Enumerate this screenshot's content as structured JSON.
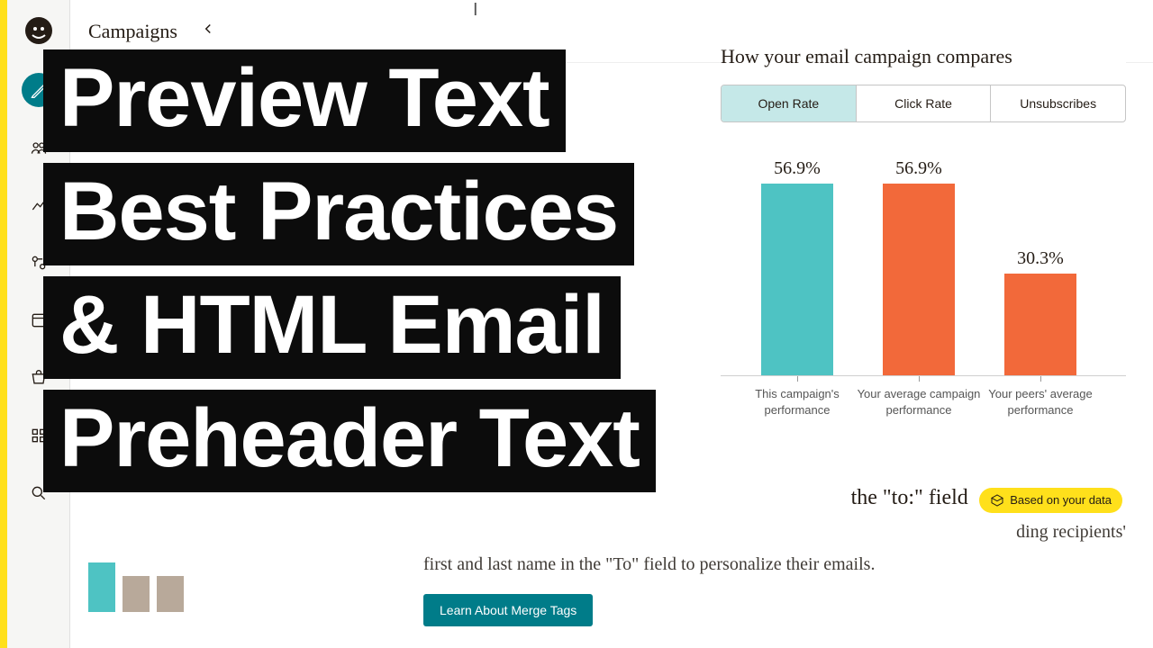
{
  "sidebar": {
    "section": "Campaigns",
    "icons": [
      "create",
      "audience",
      "analytics",
      "automations",
      "content",
      "commerce",
      "apps",
      "search"
    ]
  },
  "card": {
    "title": "How your email campaign compares",
    "tabs": [
      "Open Rate",
      "Click Rate",
      "Unsubscribes"
    ],
    "active_tab": 0
  },
  "chart_data": {
    "type": "bar",
    "title": "How your email campaign compares",
    "metric": "Open Rate",
    "categories": [
      "This campaign's performance",
      "Your average campaign performance",
      "Your peers' average performance"
    ],
    "values": [
      56.9,
      56.9,
      30.3
    ],
    "value_labels": [
      "56.9%",
      "56.9%",
      "30.3%"
    ],
    "colors": [
      "#4ec3c3",
      "#f2693a",
      "#f2693a"
    ],
    "ylim": [
      0,
      60
    ],
    "xlabel": "",
    "ylabel": ""
  },
  "lower": {
    "heading_visible_tail": "the \"to:\" field",
    "body_visible_tail": "ding recipients'",
    "body_line2": "first and last name in the \"To\" field to personalize their emails.",
    "badge": "Based on your data",
    "button": "Learn About Merge Tags"
  },
  "overlay": {
    "l1": "Preview Text",
    "l2": "Best Practices",
    "l3": "& HTML Email",
    "l4": "Preheader Text"
  }
}
